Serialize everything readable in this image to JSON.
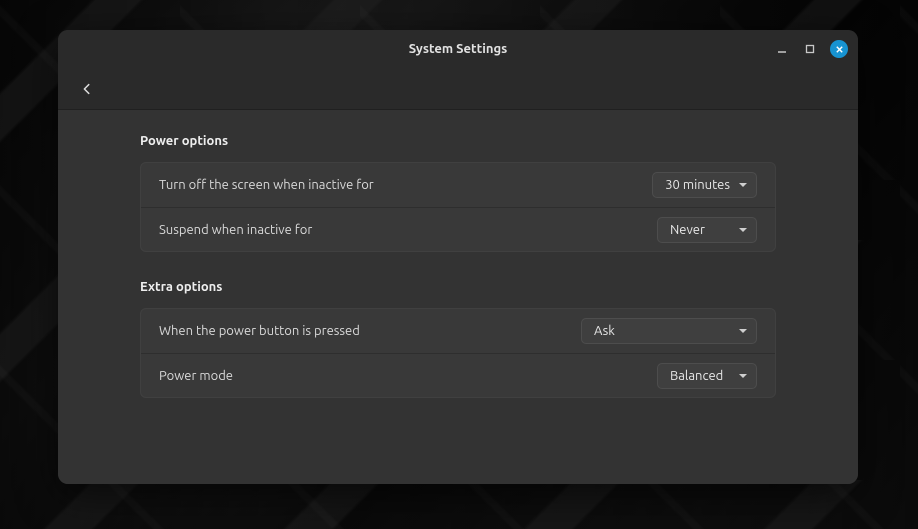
{
  "window": {
    "title": "System Settings"
  },
  "sections": {
    "power": {
      "title": "Power options",
      "screen_off": {
        "label": "Turn off the screen when inactive for",
        "value": "30 minutes"
      },
      "suspend": {
        "label": "Suspend when inactive for",
        "value": "Never"
      }
    },
    "extra": {
      "title": "Extra options",
      "power_button": {
        "label": "When the power button is pressed",
        "value": "Ask"
      },
      "power_mode": {
        "label": "Power mode",
        "value": "Balanced"
      }
    }
  }
}
